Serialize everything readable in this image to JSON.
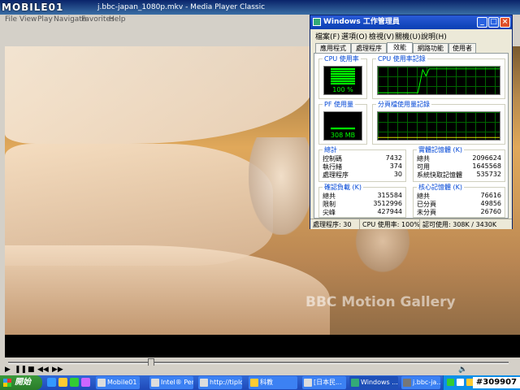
{
  "media_player": {
    "logo": "MOBILE01",
    "title": "j.bbc-japan_1080p.mkv - Media Player Classic",
    "menu": [
      "File",
      "View",
      "Play",
      "Navigate",
      "Favorites",
      "Help"
    ],
    "watermark": "BBC Motion Gallery"
  },
  "task_manager": {
    "title": "Windows 工作管理員",
    "menu": [
      "檔案(F)",
      "選項(O)",
      "檢視(V)",
      "關機(U)",
      "說明(H)"
    ],
    "tabs": [
      "應用程式",
      "處理程序",
      "效能",
      "網路功能",
      "使用者"
    ],
    "active_tab": "效能",
    "cpu_usage_label": "CPU 使用率",
    "cpu_usage_value": "100 %",
    "cpu_usage_percent": 100,
    "cpu_history_label": "CPU 使用率記錄",
    "pf_usage_label": "PF 使用量",
    "pf_usage_value": "308 MB",
    "pf_history_label": "分頁檔使用量記錄",
    "totals": {
      "label": "總計",
      "rows": [
        {
          "k": "控制碼",
          "v": "7432"
        },
        {
          "k": "執行緒",
          "v": "374"
        },
        {
          "k": "處理程序",
          "v": "30"
        }
      ]
    },
    "physical_memory": {
      "label": "實體記憶體 (K)",
      "rows": [
        {
          "k": "總共",
          "v": "2096624"
        },
        {
          "k": "可用",
          "v": "1645568"
        },
        {
          "k": "系統快取記憶體",
          "v": "535732"
        }
      ]
    },
    "commit_charge": {
      "label": "確認負載 (K)",
      "rows": [
        {
          "k": "總共",
          "v": "315584"
        },
        {
          "k": "限制",
          "v": "3512996"
        },
        {
          "k": "尖峰",
          "v": "427944"
        }
      ]
    },
    "kernel_memory": {
      "label": "核心記憶體 (K)",
      "rows": [
        {
          "k": "總共",
          "v": "76616"
        },
        {
          "k": "已分頁",
          "v": "49856"
        },
        {
          "k": "未分頁",
          "v": "26760"
        }
      ]
    },
    "status": {
      "processes": "處理程序: 30",
      "cpu": "CPU 使用率: 100%",
      "commit": "認可使用: 308K / 3430K"
    }
  },
  "taskbar": {
    "start": "開始",
    "tasks": [
      {
        "label": "Windows ..."
      },
      {
        "label": "Mobile01 ..."
      },
      {
        "label": "Intel® Pen..."
      },
      {
        "label": "http://tiplo..."
      },
      {
        "label": "科教"
      },
      {
        "label": "[日本民..."
      },
      {
        "label": "Windows ..."
      },
      {
        "label": "j.bbc-ja..."
      }
    ],
    "badge": "#309907"
  }
}
